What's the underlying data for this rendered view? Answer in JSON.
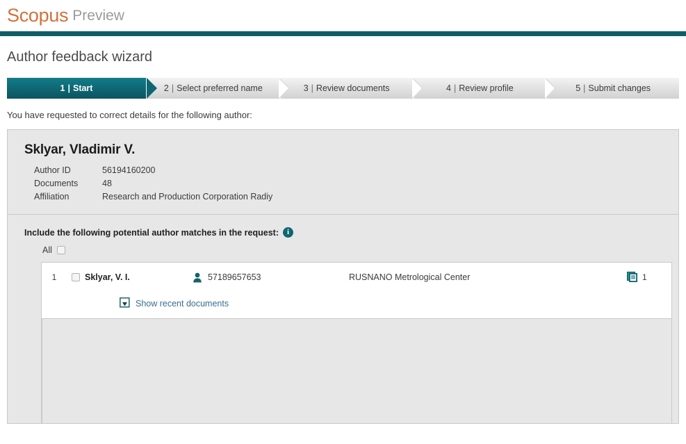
{
  "brand": {
    "name": "Scopus",
    "suffix": "Preview",
    "accent_color": "#d2703a",
    "rule_color": "#0f5e66"
  },
  "page": {
    "title": "Author feedback wizard",
    "intro": "You have requested to correct details for the following author:"
  },
  "wizard": {
    "steps": [
      {
        "number": "1",
        "separator": "|",
        "label": "Start",
        "active": true
      },
      {
        "number": "2",
        "separator": "|",
        "label": "Select preferred name",
        "active": false
      },
      {
        "number": "3",
        "separator": "|",
        "label": "Review documents",
        "active": false
      },
      {
        "number": "4",
        "separator": "|",
        "label": "Review profile",
        "active": false
      },
      {
        "number": "5",
        "separator": "|",
        "label": "Submit changes",
        "active": false
      }
    ],
    "active_color": "#0e6672",
    "inactive_color": "#e3e3e3"
  },
  "author": {
    "name": "Sklyar, Vladimir V.",
    "fields": [
      {
        "label": "Author ID",
        "value": "56194160200"
      },
      {
        "label": "Documents",
        "value": "48"
      },
      {
        "label": "Affiliation",
        "value": "Research and Production Corporation Radiy"
      }
    ]
  },
  "matches": {
    "heading": "Include the following potential author matches in the request:",
    "info_icon_glyph": "i",
    "info_icon_name": "info-icon",
    "all_label": "All",
    "all_checked": false,
    "rows": [
      {
        "index": "1",
        "checked": false,
        "name": "Sklyar, V. I.",
        "author_id": "57189657653",
        "affiliation": "RUSNANO Metrological Center",
        "document_count": "1",
        "person_icon_name": "person-icon",
        "documents_icon_name": "documents-icon"
      }
    ],
    "show_recent_label": "Show recent documents",
    "show_recent_icon_name": "show-documents-icon",
    "link_color": "#386e93"
  }
}
